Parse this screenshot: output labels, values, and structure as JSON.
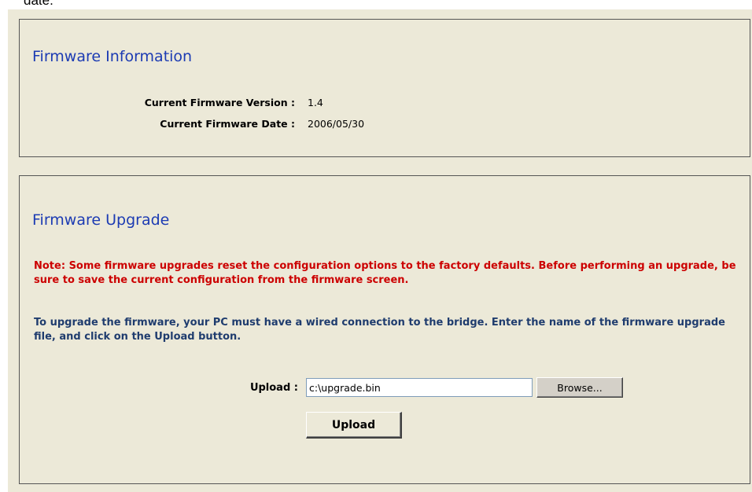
{
  "page": {
    "top_fragment": "date."
  },
  "firmware_info": {
    "title": "Firmware Information",
    "version_label": "Current Firmware Version :",
    "version_value": "1.4",
    "date_label": "Current Firmware Date :",
    "date_value": "2006/05/30"
  },
  "firmware_upgrade": {
    "title": "Firmware Upgrade",
    "note": "Note: Some firmware upgrades reset the configuration options to the factory defaults. Before performing an upgrade, be sure to save the current configuration from the firmware screen.",
    "instructions": "To upgrade the firmware, your PC must have a wired connection to the bridge. Enter the name of the firmware upgrade file, and click on the Upload button.",
    "upload_label": "Upload :",
    "file_value": "c:\\upgrade.bin",
    "browse_label": "Browse...",
    "upload_button_label": "Upload"
  },
  "colors": {
    "panel_background": "#ece9d8",
    "title_blue": "#1c3bb3",
    "note_red": "#cc0000",
    "instruction_navy": "#1f3c6e"
  }
}
